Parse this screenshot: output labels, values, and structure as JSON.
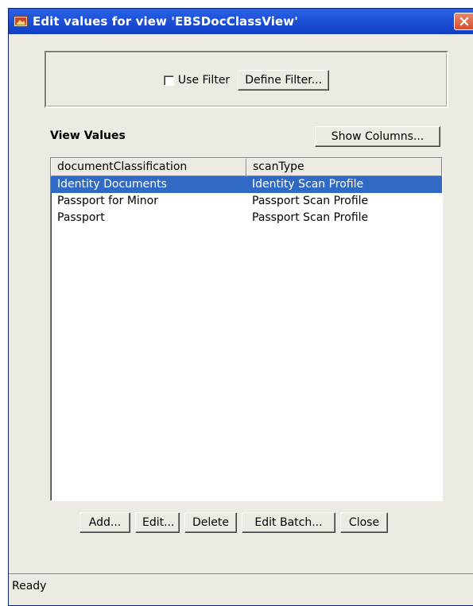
{
  "window": {
    "title": "Edit values for view 'EBSDocClassView'"
  },
  "filter": {
    "use_filter_label": "Use Filter",
    "use_filter_checked": false,
    "define_filter_label": "Define Filter..."
  },
  "view_values": {
    "label": "View Values",
    "show_columns_label": "Show Columns..."
  },
  "table": {
    "columns": [
      "documentClassification",
      "scanType"
    ],
    "rows": [
      {
        "documentClassification": "Identity Documents",
        "scanType": "Identity Scan Profile",
        "selected": true
      },
      {
        "documentClassification": "Passport for Minor",
        "scanType": "Passport Scan Profile",
        "selected": false
      },
      {
        "documentClassification": "Passport",
        "scanType": "Passport Scan Profile",
        "selected": false
      }
    ]
  },
  "buttons": {
    "add": "Add...",
    "edit": "Edit...",
    "delete": "Delete",
    "edit_batch": "Edit Batch...",
    "close": "Close"
  },
  "status": {
    "text": "Ready"
  },
  "colors": {
    "titlebar": "#1d51d8",
    "selection": "#316ac5",
    "dialog_bg": "#eceae2",
    "close_button": "#d5512c"
  },
  "icons": {
    "title": "window-app-icon",
    "close": "close-icon"
  }
}
